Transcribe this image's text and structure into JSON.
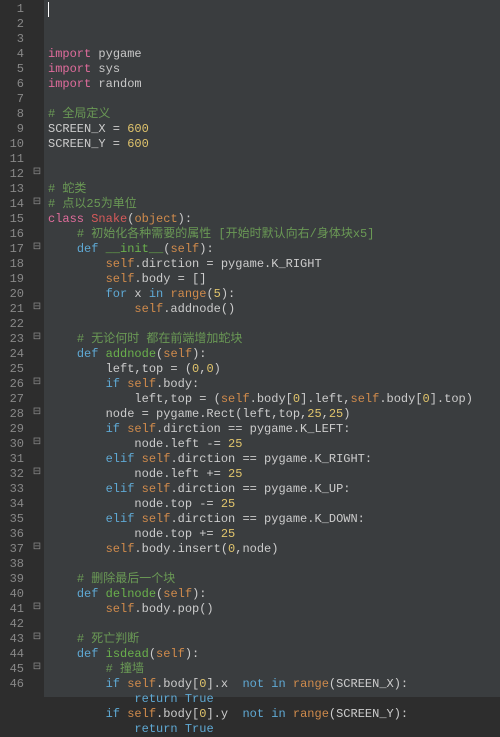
{
  "lines": [
    {
      "num": 1,
      "fold": "",
      "tokens": [
        {
          "t": "import",
          "c": "kw2"
        },
        {
          "t": " ",
          "c": ""
        },
        {
          "t": "pygame",
          "c": "mod"
        }
      ]
    },
    {
      "num": 2,
      "fold": "",
      "tokens": [
        {
          "t": "import",
          "c": "kw2"
        },
        {
          "t": " ",
          "c": ""
        },
        {
          "t": "sys",
          "c": "mod"
        }
      ]
    },
    {
      "num": 3,
      "fold": "",
      "tokens": [
        {
          "t": "import",
          "c": "kw2"
        },
        {
          "t": " ",
          "c": ""
        },
        {
          "t": "random",
          "c": "mod"
        }
      ]
    },
    {
      "num": 4,
      "fold": "",
      "tokens": []
    },
    {
      "num": 5,
      "fold": "",
      "tokens": [
        {
          "t": "# 全局定义",
          "c": "cm"
        }
      ]
    },
    {
      "num": 6,
      "fold": "",
      "tokens": [
        {
          "t": "SCREEN_X",
          "c": "id"
        },
        {
          "t": " = ",
          "c": "op"
        },
        {
          "t": "600",
          "c": "num"
        }
      ]
    },
    {
      "num": 7,
      "fold": "",
      "tokens": [
        {
          "t": "SCREEN_Y",
          "c": "id"
        },
        {
          "t": " = ",
          "c": "op"
        },
        {
          "t": "600",
          "c": "num"
        }
      ]
    },
    {
      "num": 8,
      "fold": "",
      "tokens": []
    },
    {
      "num": 9,
      "fold": "",
      "tokens": []
    },
    {
      "num": 10,
      "fold": "",
      "tokens": [
        {
          "t": "# 蛇类",
          "c": "cm"
        }
      ]
    },
    {
      "num": 11,
      "fold": "",
      "tokens": [
        {
          "t": "# 点以25为单位",
          "c": "cm"
        }
      ]
    },
    {
      "num": 12,
      "fold": "⊟",
      "tokens": [
        {
          "t": "class",
          "c": "kw2"
        },
        {
          "t": " ",
          "c": ""
        },
        {
          "t": "Snake",
          "c": "cls"
        },
        {
          "t": "(",
          "c": "op"
        },
        {
          "t": "object",
          "c": "builtin"
        },
        {
          "t": "):",
          "c": "op"
        }
      ]
    },
    {
      "num": 13,
      "fold": "",
      "indent": 1,
      "tokens": [
        {
          "t": "# 初始化各种需要的属性 [开始时默认向右/身体块x5]",
          "c": "cm"
        }
      ]
    },
    {
      "num": 14,
      "fold": "⊟",
      "indent": 1,
      "tokens": [
        {
          "t": "def",
          "c": "kw"
        },
        {
          "t": " ",
          "c": ""
        },
        {
          "t": "__init__",
          "c": "func"
        },
        {
          "t": "(",
          "c": "op"
        },
        {
          "t": "self",
          "c": "self"
        },
        {
          "t": "):",
          "c": "op"
        }
      ]
    },
    {
      "num": 15,
      "fold": "",
      "indent": 2,
      "tokens": [
        {
          "t": "self",
          "c": "self"
        },
        {
          "t": ".dirction = pygame.K_RIGHT",
          "c": "id"
        }
      ]
    },
    {
      "num": 16,
      "fold": "",
      "indent": 2,
      "tokens": [
        {
          "t": "self",
          "c": "self"
        },
        {
          "t": ".body = []",
          "c": "id"
        }
      ]
    },
    {
      "num": 17,
      "fold": "⊟",
      "indent": 2,
      "tokens": [
        {
          "t": "for",
          "c": "kw"
        },
        {
          "t": " x ",
          "c": "id"
        },
        {
          "t": "in",
          "c": "kw"
        },
        {
          "t": " ",
          "c": ""
        },
        {
          "t": "range",
          "c": "builtin"
        },
        {
          "t": "(",
          "c": "op"
        },
        {
          "t": "5",
          "c": "num"
        },
        {
          "t": "):",
          "c": "op"
        }
      ]
    },
    {
      "num": 18,
      "fold": "",
      "indent": 3,
      "tokens": [
        {
          "t": "self",
          "c": "self"
        },
        {
          "t": ".addnode()",
          "c": "id"
        }
      ]
    },
    {
      "num": 19,
      "fold": "",
      "indent": 3,
      "tokens": []
    },
    {
      "num": 20,
      "fold": "",
      "indent": 1,
      "tokens": [
        {
          "t": "# 无论何时 都在前端增加蛇块",
          "c": "cm"
        }
      ]
    },
    {
      "num": 21,
      "fold": "⊟",
      "indent": 1,
      "tokens": [
        {
          "t": "def",
          "c": "kw"
        },
        {
          "t": " ",
          "c": ""
        },
        {
          "t": "addnode",
          "c": "func"
        },
        {
          "t": "(",
          "c": "op"
        },
        {
          "t": "self",
          "c": "self"
        },
        {
          "t": "):",
          "c": "op"
        }
      ]
    },
    {
      "num": 22,
      "fold": "",
      "indent": 2,
      "tokens": [
        {
          "t": "left,top = (",
          "c": "id"
        },
        {
          "t": "0",
          "c": "num"
        },
        {
          "t": ",",
          "c": "op"
        },
        {
          "t": "0",
          "c": "num"
        },
        {
          "t": ")",
          "c": "op"
        }
      ]
    },
    {
      "num": 23,
      "fold": "⊟",
      "indent": 2,
      "tokens": [
        {
          "t": "if",
          "c": "kw"
        },
        {
          "t": " ",
          "c": ""
        },
        {
          "t": "self",
          "c": "self"
        },
        {
          "t": ".body:",
          "c": "id"
        }
      ]
    },
    {
      "num": 24,
      "fold": "",
      "indent": 3,
      "tokens": [
        {
          "t": "left,top = (",
          "c": "id"
        },
        {
          "t": "self",
          "c": "self"
        },
        {
          "t": ".body[",
          "c": "id"
        },
        {
          "t": "0",
          "c": "num"
        },
        {
          "t": "].left,",
          "c": "id"
        },
        {
          "t": "self",
          "c": "self"
        },
        {
          "t": ".body[",
          "c": "id"
        },
        {
          "t": "0",
          "c": "num"
        },
        {
          "t": "].top)",
          "c": "id"
        }
      ]
    },
    {
      "num": 25,
      "fold": "",
      "indent": 2,
      "tokens": [
        {
          "t": "node = pygame.Rect(left,top,",
          "c": "id"
        },
        {
          "t": "25",
          "c": "num"
        },
        {
          "t": ",",
          "c": "op"
        },
        {
          "t": "25",
          "c": "num"
        },
        {
          "t": ")",
          "c": "op"
        }
      ]
    },
    {
      "num": 26,
      "fold": "⊟",
      "indent": 2,
      "tokens": [
        {
          "t": "if",
          "c": "kw"
        },
        {
          "t": " ",
          "c": ""
        },
        {
          "t": "self",
          "c": "self"
        },
        {
          "t": ".dirction == pygame.K_LEFT:",
          "c": "id"
        }
      ]
    },
    {
      "num": 27,
      "fold": "",
      "indent": 3,
      "tokens": [
        {
          "t": "node.left -= ",
          "c": "id"
        },
        {
          "t": "25",
          "c": "num"
        }
      ]
    },
    {
      "num": 28,
      "fold": "⊟",
      "indent": 2,
      "tokens": [
        {
          "t": "elif",
          "c": "kw"
        },
        {
          "t": " ",
          "c": ""
        },
        {
          "t": "self",
          "c": "self"
        },
        {
          "t": ".dirction == pygame.K_RIGHT:",
          "c": "id"
        }
      ]
    },
    {
      "num": 29,
      "fold": "",
      "indent": 3,
      "tokens": [
        {
          "t": "node.left += ",
          "c": "id"
        },
        {
          "t": "25",
          "c": "num"
        }
      ]
    },
    {
      "num": 30,
      "fold": "⊟",
      "indent": 2,
      "tokens": [
        {
          "t": "elif",
          "c": "kw"
        },
        {
          "t": " ",
          "c": ""
        },
        {
          "t": "self",
          "c": "self"
        },
        {
          "t": ".dirction == pygame.K_UP:",
          "c": "id"
        }
      ]
    },
    {
      "num": 31,
      "fold": "",
      "indent": 3,
      "tokens": [
        {
          "t": "node.top -= ",
          "c": "id"
        },
        {
          "t": "25",
          "c": "num"
        }
      ]
    },
    {
      "num": 32,
      "fold": "⊟",
      "indent": 2,
      "tokens": [
        {
          "t": "elif",
          "c": "kw"
        },
        {
          "t": " ",
          "c": ""
        },
        {
          "t": "self",
          "c": "self"
        },
        {
          "t": ".dirction == pygame.K_DOWN:",
          "c": "id"
        }
      ]
    },
    {
      "num": 33,
      "fold": "",
      "indent": 3,
      "tokens": [
        {
          "t": "node.top += ",
          "c": "id"
        },
        {
          "t": "25",
          "c": "num"
        }
      ]
    },
    {
      "num": 34,
      "fold": "",
      "indent": 2,
      "tokens": [
        {
          "t": "self",
          "c": "self"
        },
        {
          "t": ".body.insert(",
          "c": "id"
        },
        {
          "t": "0",
          "c": "num"
        },
        {
          "t": ",node)",
          "c": "id"
        }
      ]
    },
    {
      "num": 35,
      "fold": "",
      "indent": 2,
      "tokens": []
    },
    {
      "num": 36,
      "fold": "",
      "indent": 1,
      "tokens": [
        {
          "t": "# 删除最后一个块",
          "c": "cm"
        }
      ]
    },
    {
      "num": 37,
      "fold": "⊟",
      "indent": 1,
      "tokens": [
        {
          "t": "def",
          "c": "kw"
        },
        {
          "t": " ",
          "c": ""
        },
        {
          "t": "delnode",
          "c": "func"
        },
        {
          "t": "(",
          "c": "op"
        },
        {
          "t": "self",
          "c": "self"
        },
        {
          "t": "):",
          "c": "op"
        }
      ]
    },
    {
      "num": 38,
      "fold": "",
      "indent": 2,
      "tokens": [
        {
          "t": "self",
          "c": "self"
        },
        {
          "t": ".body.pop()",
          "c": "id"
        }
      ]
    },
    {
      "num": 39,
      "fold": "",
      "indent": 2,
      "tokens": []
    },
    {
      "num": 40,
      "fold": "",
      "indent": 1,
      "tokens": [
        {
          "t": "# 死亡判断",
          "c": "cm"
        }
      ]
    },
    {
      "num": 41,
      "fold": "⊟",
      "indent": 1,
      "tokens": [
        {
          "t": "def",
          "c": "kw"
        },
        {
          "t": " ",
          "c": ""
        },
        {
          "t": "isdead",
          "c": "func"
        },
        {
          "t": "(",
          "c": "op"
        },
        {
          "t": "self",
          "c": "self"
        },
        {
          "t": "):",
          "c": "op"
        }
      ]
    },
    {
      "num": 42,
      "fold": "",
      "indent": 2,
      "tokens": [
        {
          "t": "# 撞墙",
          "c": "cm"
        }
      ]
    },
    {
      "num": 43,
      "fold": "⊟",
      "indent": 2,
      "tokens": [
        {
          "t": "if",
          "c": "kw"
        },
        {
          "t": " ",
          "c": ""
        },
        {
          "t": "self",
          "c": "self"
        },
        {
          "t": ".body[",
          "c": "id"
        },
        {
          "t": "0",
          "c": "num"
        },
        {
          "t": "].x  ",
          "c": "id"
        },
        {
          "t": "not",
          "c": "kw"
        },
        {
          "t": " ",
          "c": ""
        },
        {
          "t": "in",
          "c": "kw"
        },
        {
          "t": " ",
          "c": ""
        },
        {
          "t": "range",
          "c": "builtin"
        },
        {
          "t": "(SCREEN_X):",
          "c": "id"
        }
      ]
    },
    {
      "num": 44,
      "fold": "",
      "indent": 3,
      "tokens": [
        {
          "t": "return",
          "c": "kw"
        },
        {
          "t": " ",
          "c": ""
        },
        {
          "t": "True",
          "c": "kw"
        }
      ]
    },
    {
      "num": 45,
      "fold": "⊟",
      "indent": 2,
      "tokens": [
        {
          "t": "if",
          "c": "kw"
        },
        {
          "t": " ",
          "c": ""
        },
        {
          "t": "self",
          "c": "self"
        },
        {
          "t": ".body[",
          "c": "id"
        },
        {
          "t": "0",
          "c": "num"
        },
        {
          "t": "].y  ",
          "c": "id"
        },
        {
          "t": "not",
          "c": "kw"
        },
        {
          "t": " ",
          "c": ""
        },
        {
          "t": "in",
          "c": "kw"
        },
        {
          "t": " ",
          "c": ""
        },
        {
          "t": "range",
          "c": "builtin"
        },
        {
          "t": "(SCREEN_Y):",
          "c": "id"
        }
      ]
    },
    {
      "num": 46,
      "fold": "",
      "indent": 3,
      "tokens": [
        {
          "t": "return",
          "c": "kw"
        },
        {
          "t": " ",
          "c": ""
        },
        {
          "t": "True",
          "c": "kw"
        }
      ]
    }
  ]
}
